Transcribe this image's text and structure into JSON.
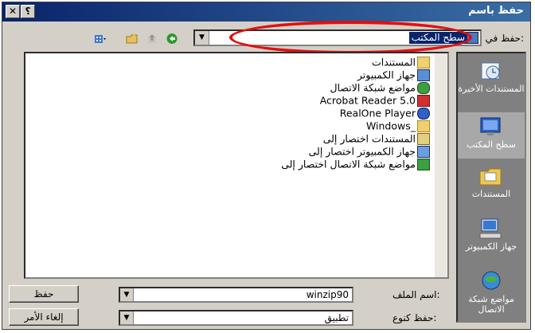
{
  "window": {
    "title": "حفظ باسم",
    "help_label": "؟",
    "close_label": "✕"
  },
  "lookin": {
    "label": "حفظ في:",
    "value": "سطح المكتب"
  },
  "files": [
    {
      "label": "المستندات",
      "icon": "folder-icon"
    },
    {
      "label": "جهاز الكمبيوتر",
      "icon": "computer-icon"
    },
    {
      "label": "مواضع شبكة الاتصال",
      "icon": "network-icon"
    },
    {
      "label": "Acrobat Reader 5.0",
      "icon": "acrobat-shortcut-icon"
    },
    {
      "label": "RealOne Player",
      "icon": "realone-shortcut-icon"
    },
    {
      "label": "Windows_",
      "icon": "folder-icon"
    },
    {
      "label": "المستندات اختصار إلى",
      "icon": "shortcut-icon"
    },
    {
      "label": "جهاز الكمبيوتر اختصار إلى",
      "icon": "shortcut-icon"
    },
    {
      "label": "مواضع شبكة الاتصال اختصار إلى",
      "icon": "shortcut-icon"
    }
  ],
  "places": [
    {
      "label": "المستندات الأخيرة",
      "icon": "recent-documents-icon"
    },
    {
      "label": "سطح المكتب",
      "icon": "desktop-icon"
    },
    {
      "label": "المستندات",
      "icon": "my-documents-icon"
    },
    {
      "label": "جهاز الكمبيوتر",
      "icon": "my-computer-icon"
    },
    {
      "label": "مواضع شبكة الاتصال",
      "icon": "network-places-icon"
    }
  ],
  "filename": {
    "label": "اسم الملف:",
    "value": "winzip90"
  },
  "filetype": {
    "label": "حفظ كنوع:",
    "value": "تطبيق"
  },
  "buttons": {
    "save": "حفظ",
    "cancel": "إلغاء الأمر"
  },
  "colors": {
    "titlebar": "#0a246a",
    "selection": "#0a246a",
    "highlight_oval": "#e01010"
  }
}
